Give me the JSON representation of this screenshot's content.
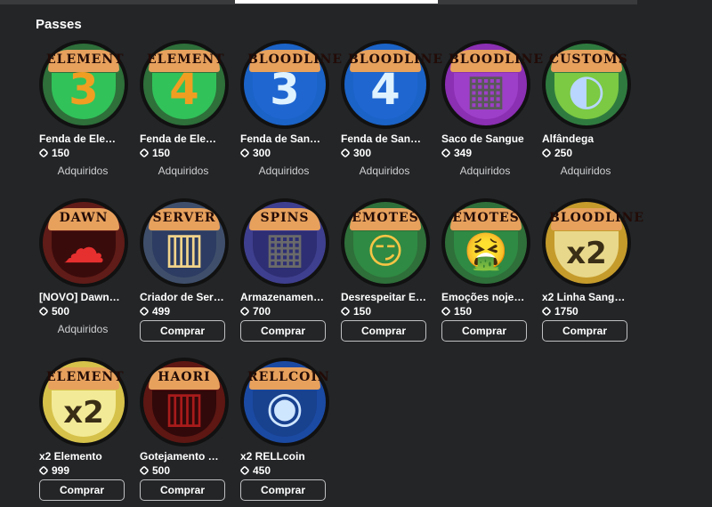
{
  "section_title": "Passes",
  "passes": [
    {
      "name": "Fenda de Ele…",
      "price": "150",
      "status": "Adquiridos",
      "badge": {
        "label": "ELEMENT",
        "glyph": "3",
        "ring": "#2e6f3a",
        "center": "#31c25a",
        "glyph_color": "#ef9e22"
      }
    },
    {
      "name": "Fenda de Ele…",
      "price": "150",
      "status": "Adquiridos",
      "badge": {
        "label": "ELEMENT",
        "glyph": "4",
        "ring": "#2e6f3a",
        "center": "#31c25a",
        "glyph_color": "#ef9e22"
      }
    },
    {
      "name": "Fenda de San…",
      "price": "300",
      "status": "Adquiridos",
      "badge": {
        "label": "BLOODLINE",
        "glyph": "3",
        "ring": "#1b63c7",
        "center": "#1f66d1",
        "glyph_color": "#dff2ff"
      }
    },
    {
      "name": "Fenda de San…",
      "price": "300",
      "status": "Adquiridos",
      "badge": {
        "label": "BLOODLINE",
        "glyph": "4",
        "ring": "#1b63c7",
        "center": "#1f66d1",
        "glyph_color": "#dff2ff"
      }
    },
    {
      "name": "Saco de Sangue",
      "price": "349",
      "status": "Adquiridos",
      "badge": {
        "label": "BLOODLINE",
        "glyph": "▦",
        "ring": "#8b2fb3",
        "center": "#9d3fc8",
        "glyph_color": "#595959"
      }
    },
    {
      "name": "Alfândega",
      "price": "250",
      "status": "Adquiridos",
      "badge": {
        "label": "CUSTOMS",
        "glyph": "◐",
        "ring": "#2f7b3f",
        "center": "#7cc943",
        "glyph_color": "#b8d6ff"
      }
    },
    {
      "name": "[NOVO] Dawn…",
      "price": "500",
      "status": "Adquiridos",
      "badge": {
        "label": "DAWN",
        "glyph": "☁",
        "ring": "#601c18",
        "center": "#3a0b0b",
        "glyph_color": "#e62f2f"
      }
    },
    {
      "name": "Criador de Ser…",
      "price": "499",
      "status": "Comprar",
      "badge": {
        "label": "SERVER",
        "glyph": "▥",
        "ring": "#3f4f6b",
        "center": "#2c3c62",
        "glyph_color": "#f1d38a"
      }
    },
    {
      "name": "Armazenamen…",
      "price": "700",
      "status": "Comprar",
      "badge": {
        "label": "SPINS",
        "glyph": "▦",
        "ring": "#3f3f8f",
        "center": "#2d2e73",
        "glyph_color": "#6a6a6a"
      }
    },
    {
      "name": "Desrespeitar E…",
      "price": "150",
      "status": "Comprar",
      "badge": {
        "label": "EMOTES",
        "glyph": "😏",
        "ring": "#2f6f3a",
        "center": "#2f8a43",
        "glyph_color": "#f6c445"
      }
    },
    {
      "name": "Emoções noje…",
      "price": "150",
      "status": "Comprar",
      "badge": {
        "label": "EMOTES",
        "glyph": "🤮",
        "ring": "#2f6f3a",
        "center": "#2f8a43",
        "glyph_color": "#f6c445"
      }
    },
    {
      "name": "x2 Linha Sang…",
      "price": "1750",
      "status": "Comprar",
      "badge": {
        "label": "BLOODLINE",
        "glyph": "x2",
        "ring": "#c59b2b",
        "center": "#e8d88b",
        "glyph_color": "#3a2e16"
      }
    },
    {
      "name": "x2 Elemento",
      "price": "999",
      "status": "Comprar",
      "badge": {
        "label": "ELEMENT",
        "glyph": "x2",
        "ring": "#d6c24a",
        "center": "#f3ea97",
        "glyph_color": "#3a2e16"
      }
    },
    {
      "name": "Gotejamento …",
      "price": "500",
      "status": "Comprar",
      "badge": {
        "label": "HAORI",
        "glyph": "▥",
        "ring": "#5e1713",
        "center": "#31090a",
        "glyph_color": "#a81b1b"
      }
    },
    {
      "name": "x2 RELLcoin",
      "price": "450",
      "status": "Comprar",
      "badge": {
        "label": "RELLCOIN",
        "glyph": "◉",
        "ring": "#1b4aa3",
        "center": "#18418e",
        "glyph_color": "#cfe6ff"
      }
    }
  ]
}
